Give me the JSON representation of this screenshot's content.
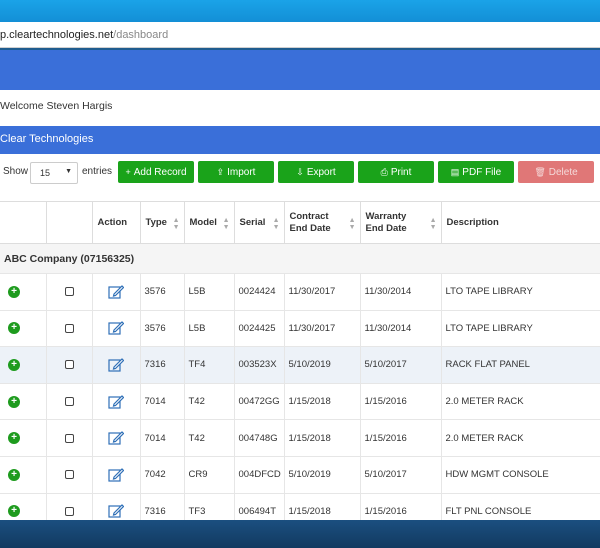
{
  "browser": {
    "address": "p.cleartechnologies.net",
    "path": "/dashboard"
  },
  "welcome": "Welcome Steven Hargis",
  "app_title": "Clear Technologies",
  "controls": {
    "show_label": "Show",
    "entries_value": "15",
    "entries_label": "entries",
    "buttons": [
      {
        "label": "Add Record",
        "icon": "+"
      },
      {
        "label": "Import",
        "icon": "⇪"
      },
      {
        "label": "Export",
        "icon": "⇩"
      },
      {
        "label": "Print",
        "icon": "⎙"
      },
      {
        "label": "PDF File",
        "icon": "▤"
      },
      {
        "label": "Delete",
        "icon": "🗑"
      }
    ]
  },
  "table": {
    "headers": [
      "",
      "",
      "Action",
      "Type",
      "Model",
      "Serial",
      "Contract End Date",
      "Warranty End Date",
      "Description"
    ],
    "group": "ABC Company (07156325)",
    "rows": [
      {
        "type": "3576",
        "model": "L5B",
        "serial": "0024424",
        "contract": "11/30/2017",
        "warranty": "11/30/2014",
        "desc": "LTO TAPE LIBRARY"
      },
      {
        "type": "3576",
        "model": "L5B",
        "serial": "0024425",
        "contract": "11/30/2017",
        "warranty": "11/30/2014",
        "desc": "LTO TAPE LIBRARY"
      },
      {
        "type": "7316",
        "model": "TF4",
        "serial": "003523X",
        "contract": "5/10/2019",
        "warranty": "5/10/2017",
        "desc": "RACK FLAT PANEL"
      },
      {
        "type": "7014",
        "model": "T42",
        "serial": "00472GG",
        "contract": "1/15/2018",
        "warranty": "1/15/2016",
        "desc": "2.0 METER RACK"
      },
      {
        "type": "7014",
        "model": "T42",
        "serial": "004748G",
        "contract": "1/15/2018",
        "warranty": "1/15/2016",
        "desc": "2.0 METER RACK"
      },
      {
        "type": "7042",
        "model": "CR9",
        "serial": "004DFCD",
        "contract": "5/10/2019",
        "warranty": "5/10/2017",
        "desc": "HDW MGMT CONSOLE"
      },
      {
        "type": "7316",
        "model": "TF3",
        "serial": "006494T",
        "contract": "1/15/2018",
        "warranty": "1/15/2016",
        "desc": "FLT PNL CONSOLE"
      }
    ]
  },
  "colors": {
    "header_blue": "#3a6fd9",
    "button_green": "#1aa31a",
    "button_red": "#e07777"
  }
}
